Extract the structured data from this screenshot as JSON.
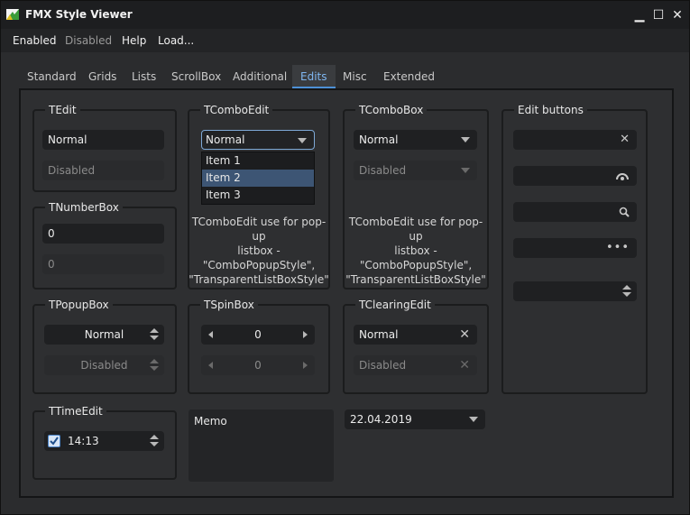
{
  "window": {
    "title": "FMX Style Viewer",
    "accent": "#4d90d6"
  },
  "menu": [
    "Enabled",
    "Disabled",
    "Help",
    "Load..."
  ],
  "tabs": [
    "Standard",
    "Grids",
    "Lists",
    "ScrollBox",
    "Additional",
    "Edits",
    "Misc",
    "Extended"
  ],
  "active_tab": "Edits",
  "tedit": {
    "title": "TEdit",
    "normal": "Normal",
    "disabled": "Disabled"
  },
  "tnumberbox": {
    "title": "TNumberBox",
    "value1": "0",
    "value2": "0"
  },
  "tpopupbox": {
    "title": "TPopupBox",
    "normal": "Normal",
    "disabled": "Disabled"
  },
  "ttimeedit": {
    "title": "TTimeEdit",
    "value": "14:13",
    "checked": true
  },
  "tcomboedit": {
    "title": "TComboEdit",
    "value": "Normal",
    "items": [
      "Item 1",
      "Item 2",
      "Item 3"
    ],
    "selected_index": 1,
    "note": [
      "TComboEdit use for pop-up",
      "listbox -",
      "\"ComboPopupStyle\",",
      "\"TransparentListBoxStyle\""
    ]
  },
  "tspinbox": {
    "title": "TSpinBox",
    "value1": "0",
    "value2": "0"
  },
  "memo": {
    "text": "Memo"
  },
  "tcombobox": {
    "title": "TComboBox",
    "normal": "Normal",
    "disabled": "Disabled",
    "note": [
      "TComboEdit use for pop-up",
      "listbox -",
      "\"ComboPopupStyle\",",
      "\"TransparentListBoxStyle\""
    ]
  },
  "tclearingedit": {
    "title": "TClearingEdit",
    "normal": "Normal",
    "disabled": "Disabled"
  },
  "date": {
    "value": "22.04.2019"
  },
  "edit_buttons": {
    "title": "Edit buttons",
    "icons": [
      "clear-icon",
      "password-eye-icon",
      "search-icon",
      "ellipsis-icon",
      "spin-icon"
    ]
  }
}
